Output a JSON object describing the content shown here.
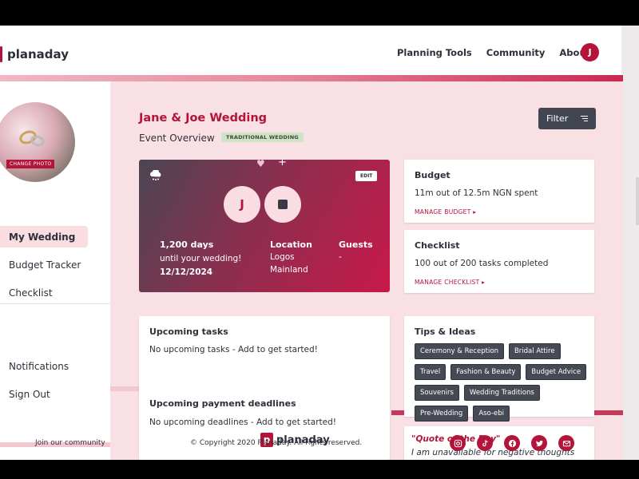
{
  "header": {
    "logo_text": "planaday",
    "nav": [
      "Planning Tools",
      "Community",
      "About"
    ],
    "avatar_initial": "J"
  },
  "sidebar": {
    "change_photo": "CHANGE PHOTO",
    "items": [
      "My Wedding",
      "Budget Tracker",
      "Checklist"
    ],
    "secondary_items": [
      "Notifications",
      "Sign Out"
    ],
    "join": "Join our community"
  },
  "event": {
    "title": "Jane & Joe Wedding",
    "overview": "Event Overview",
    "tag": "TRADITIONAL WEDDING",
    "filter": "Filter"
  },
  "hero": {
    "edit": "EDIT",
    "initial_left": "J",
    "days": "1,200 days",
    "until": "until your wedding!",
    "date": "12/12/2024",
    "location_label": "Location",
    "location_line1": "Logos",
    "location_line2": "Mainland",
    "guests_label": "Guests",
    "guests_value": "-"
  },
  "budget": {
    "title": "Budget",
    "text": "11m out of 12.5m NGN spent",
    "link": "MANAGE BUDGET ▸"
  },
  "checklist": {
    "title": "Checklist",
    "text": "100 out of 200 tasks completed",
    "link": "MANAGE CHECKLIST ▸"
  },
  "tasks": {
    "title": "Upcoming tasks",
    "empty": "No upcoming tasks - Add to get started!",
    "payments_title": "Upcoming payment deadlines",
    "payments_empty": "No upcoming deadlines - Add to get started!"
  },
  "tips": {
    "title": "Tips & Ideas",
    "chips": [
      "Ceremony & Reception",
      "Bridal Attire",
      "Travel",
      "Fashion & Beauty",
      "Budget Advice",
      "Souvenirs",
      "Wedding Traditions",
      "Pre-Wedding",
      "Aso-ebi"
    ]
  },
  "quote": {
    "title": "\"Quote of the Day\"",
    "text": "I am unavailable for negative thoughts"
  },
  "footer": {
    "logo_text": "planaday",
    "logo_mark": "p",
    "copyright": "© Copyright 2020 Planaday. All rights reserved.",
    "socials": [
      "instagram-icon",
      "tiktok-icon",
      "facebook-icon",
      "twitter-icon",
      "email-icon"
    ]
  },
  "colors": {
    "brand": "#b3143a",
    "background": "#f9e0e4",
    "chip": "#454a54",
    "tag": "#cfe3c7"
  }
}
